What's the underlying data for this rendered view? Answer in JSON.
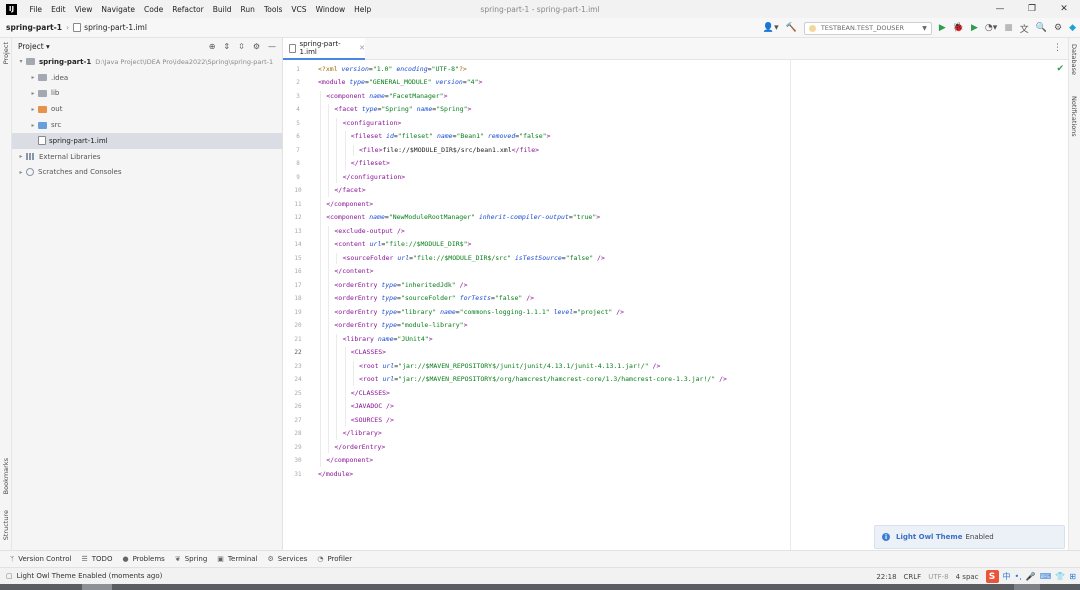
{
  "window": {
    "title": "spring-part-1 - spring-part-1.iml",
    "logo": "IJ",
    "menu": [
      "File",
      "Edit",
      "View",
      "Navigate",
      "Code",
      "Refactor",
      "Build",
      "Run",
      "Tools",
      "VCS",
      "Window",
      "Help"
    ]
  },
  "navbar": {
    "project": "spring-part-1",
    "file": "spring-part-1.iml",
    "run_config": "TESTBEAN.TEST_DOUSER"
  },
  "left_strip": {
    "top": "Project",
    "bookmarks": "Bookmarks",
    "structure": "Structure"
  },
  "right_strip": {
    "database": "Database",
    "notifications": "Notifications"
  },
  "project_panel": {
    "title": "Project",
    "tree": [
      {
        "label": "spring-part-1",
        "path": "D:\\Java Project\\IDEA Pro\\idea2022\\Spring\\spring-part-1",
        "indent": 0,
        "arrow": "▾",
        "icon": "folder-grey",
        "bold": true
      },
      {
        "label": ".idea",
        "indent": 1,
        "arrow": "▸",
        "icon": "folder-grey"
      },
      {
        "label": "lib",
        "indent": 1,
        "arrow": "▸",
        "icon": "folder-grey"
      },
      {
        "label": "out",
        "indent": 1,
        "arrow": "▸",
        "icon": "folder-orange"
      },
      {
        "label": "src",
        "indent": 1,
        "arrow": "▸",
        "icon": "folder-blue"
      },
      {
        "label": "spring-part-1.iml",
        "indent": 1,
        "arrow": "",
        "icon": "file",
        "selected": true
      },
      {
        "label": "External Libraries",
        "indent": 0,
        "arrow": "▸",
        "icon": "lib"
      },
      {
        "label": "Scratches and Consoles",
        "indent": 0,
        "arrow": "▸",
        "icon": "scratch"
      }
    ]
  },
  "editor": {
    "tab": "spring-part-1.iml",
    "active_line": 22,
    "lines": [
      {
        "n": 1,
        "indent": 0,
        "tokens": [
          [
            "pi",
            "<?xml "
          ],
          [
            "a",
            "version"
          ],
          [
            "p",
            "="
          ],
          [
            "v",
            "\"1.0\""
          ],
          [
            "p",
            " "
          ],
          [
            "a",
            "encoding"
          ],
          [
            "p",
            "="
          ],
          [
            "v",
            "\"UTF-8\""
          ],
          [
            "pi",
            "?>"
          ]
        ]
      },
      {
        "n": 2,
        "indent": 0,
        "tokens": [
          [
            "t",
            "<module "
          ],
          [
            "a",
            "type"
          ],
          [
            "p",
            "="
          ],
          [
            "v",
            "\"GENERAL_MODULE\""
          ],
          [
            "p",
            " "
          ],
          [
            "a",
            "version"
          ],
          [
            "p",
            "="
          ],
          [
            "v",
            "\"4\""
          ],
          [
            "t",
            ">"
          ]
        ]
      },
      {
        "n": 3,
        "indent": 1,
        "tokens": [
          [
            "t",
            "<component "
          ],
          [
            "a",
            "name"
          ],
          [
            "p",
            "="
          ],
          [
            "v",
            "\"FacetManager\""
          ],
          [
            "t",
            ">"
          ]
        ]
      },
      {
        "n": 4,
        "indent": 2,
        "tokens": [
          [
            "t",
            "<facet "
          ],
          [
            "a",
            "type"
          ],
          [
            "p",
            "="
          ],
          [
            "v",
            "\"Spring\""
          ],
          [
            "p",
            " "
          ],
          [
            "a",
            "name"
          ],
          [
            "p",
            "="
          ],
          [
            "v",
            "\"Spring\""
          ],
          [
            "t",
            ">"
          ]
        ]
      },
      {
        "n": 5,
        "indent": 3,
        "tokens": [
          [
            "t",
            "<configuration>"
          ]
        ]
      },
      {
        "n": 6,
        "indent": 4,
        "tokens": [
          [
            "t",
            "<fileset "
          ],
          [
            "a",
            "id"
          ],
          [
            "p",
            "="
          ],
          [
            "v",
            "\"fileset\""
          ],
          [
            "p",
            " "
          ],
          [
            "a",
            "name"
          ],
          [
            "p",
            "="
          ],
          [
            "v",
            "\"Bean1\""
          ],
          [
            "p",
            " "
          ],
          [
            "a",
            "removed"
          ],
          [
            "p",
            "="
          ],
          [
            "v",
            "\"false\""
          ],
          [
            "t",
            ">"
          ]
        ]
      },
      {
        "n": 7,
        "indent": 5,
        "tokens": [
          [
            "t",
            "<file>"
          ],
          [
            "p",
            "file://$MODULE_DIR$/src/bean1.xml"
          ],
          [
            "t",
            "</file>"
          ]
        ]
      },
      {
        "n": 8,
        "indent": 4,
        "tokens": [
          [
            "t",
            "</fileset>"
          ]
        ]
      },
      {
        "n": 9,
        "indent": 3,
        "tokens": [
          [
            "t",
            "</configuration>"
          ]
        ]
      },
      {
        "n": 10,
        "indent": 2,
        "tokens": [
          [
            "t",
            "</facet>"
          ]
        ]
      },
      {
        "n": 11,
        "indent": 1,
        "tokens": [
          [
            "t",
            "</component>"
          ]
        ]
      },
      {
        "n": 12,
        "indent": 1,
        "tokens": [
          [
            "t",
            "<component "
          ],
          [
            "a",
            "name"
          ],
          [
            "p",
            "="
          ],
          [
            "v",
            "\"NewModuleRootManager\""
          ],
          [
            "p",
            " "
          ],
          [
            "a",
            "inherit-compiler-output"
          ],
          [
            "p",
            "="
          ],
          [
            "v",
            "\"true\""
          ],
          [
            "t",
            ">"
          ]
        ]
      },
      {
        "n": 13,
        "indent": 2,
        "tokens": [
          [
            "t",
            "<exclude-output "
          ],
          [
            "t",
            "/>"
          ]
        ]
      },
      {
        "n": 14,
        "indent": 2,
        "tokens": [
          [
            "t",
            "<content "
          ],
          [
            "a",
            "url"
          ],
          [
            "p",
            "="
          ],
          [
            "v",
            "\"file://$MODULE_DIR$\""
          ],
          [
            "t",
            ">"
          ]
        ]
      },
      {
        "n": 15,
        "indent": 3,
        "tokens": [
          [
            "t",
            "<sourceFolder "
          ],
          [
            "a",
            "url"
          ],
          [
            "p",
            "="
          ],
          [
            "v",
            "\"file://$MODULE_DIR$/src\""
          ],
          [
            "p",
            " "
          ],
          [
            "a",
            "isTestSource"
          ],
          [
            "p",
            "="
          ],
          [
            "v",
            "\"false\""
          ],
          [
            "p",
            " "
          ],
          [
            "t",
            "/>"
          ]
        ]
      },
      {
        "n": 16,
        "indent": 2,
        "tokens": [
          [
            "t",
            "</content>"
          ]
        ]
      },
      {
        "n": 17,
        "indent": 2,
        "tokens": [
          [
            "t",
            "<orderEntry "
          ],
          [
            "a",
            "type"
          ],
          [
            "p",
            "="
          ],
          [
            "v",
            "\"inheritedJdk\""
          ],
          [
            "p",
            " "
          ],
          [
            "t",
            "/>"
          ]
        ]
      },
      {
        "n": 18,
        "indent": 2,
        "tokens": [
          [
            "t",
            "<orderEntry "
          ],
          [
            "a",
            "type"
          ],
          [
            "p",
            "="
          ],
          [
            "v",
            "\"sourceFolder\""
          ],
          [
            "p",
            " "
          ],
          [
            "a",
            "forTests"
          ],
          [
            "p",
            "="
          ],
          [
            "v",
            "\"false\""
          ],
          [
            "p",
            " "
          ],
          [
            "t",
            "/>"
          ]
        ]
      },
      {
        "n": 19,
        "indent": 2,
        "tokens": [
          [
            "t",
            "<orderEntry "
          ],
          [
            "a",
            "type"
          ],
          [
            "p",
            "="
          ],
          [
            "v",
            "\"library\""
          ],
          [
            "p",
            " "
          ],
          [
            "a",
            "name"
          ],
          [
            "p",
            "="
          ],
          [
            "v",
            "\"commons-logging-1.1.1\""
          ],
          [
            "p",
            " "
          ],
          [
            "a",
            "level"
          ],
          [
            "p",
            "="
          ],
          [
            "v",
            "\"project\""
          ],
          [
            "p",
            " "
          ],
          [
            "t",
            "/>"
          ]
        ]
      },
      {
        "n": 20,
        "indent": 2,
        "tokens": [
          [
            "t",
            "<orderEntry "
          ],
          [
            "a",
            "type"
          ],
          [
            "p",
            "="
          ],
          [
            "v",
            "\"module-library\""
          ],
          [
            "t",
            ">"
          ]
        ]
      },
      {
        "n": 21,
        "indent": 3,
        "tokens": [
          [
            "t",
            "<library "
          ],
          [
            "a",
            "name"
          ],
          [
            "p",
            "="
          ],
          [
            "v",
            "\"JUnit4\""
          ],
          [
            "t",
            ">"
          ]
        ]
      },
      {
        "n": 22,
        "indent": 4,
        "tokens": [
          [
            "t",
            "<CLASSES>"
          ]
        ]
      },
      {
        "n": 23,
        "indent": 5,
        "tokens": [
          [
            "t",
            "<root "
          ],
          [
            "a",
            "url"
          ],
          [
            "p",
            "="
          ],
          [
            "v",
            "\"jar://$MAVEN_REPOSITORY$/junit/junit/4.13.1/junit-4.13.1.jar!/\""
          ],
          [
            "p",
            " "
          ],
          [
            "t",
            "/>"
          ]
        ]
      },
      {
        "n": 24,
        "indent": 5,
        "tokens": [
          [
            "t",
            "<root "
          ],
          [
            "a",
            "url"
          ],
          [
            "p",
            "="
          ],
          [
            "v",
            "\"jar://$MAVEN_REPOSITORY$/org/hamcrest/hamcrest-core/1.3/hamcrest-core-1.3.jar!/\""
          ],
          [
            "p",
            " "
          ],
          [
            "t",
            "/>"
          ]
        ]
      },
      {
        "n": 25,
        "indent": 4,
        "tokens": [
          [
            "t",
            "</CLASSES>"
          ]
        ]
      },
      {
        "n": 26,
        "indent": 4,
        "tokens": [
          [
            "t",
            "<JAVADOC "
          ],
          [
            "t",
            "/>"
          ]
        ]
      },
      {
        "n": 27,
        "indent": 4,
        "tokens": [
          [
            "t",
            "<SOURCES "
          ],
          [
            "t",
            "/>"
          ]
        ]
      },
      {
        "n": 28,
        "indent": 3,
        "tokens": [
          [
            "t",
            "</library>"
          ]
        ]
      },
      {
        "n": 29,
        "indent": 2,
        "tokens": [
          [
            "t",
            "</orderEntry>"
          ]
        ]
      },
      {
        "n": 30,
        "indent": 1,
        "tokens": [
          [
            "t",
            "</component>"
          ]
        ]
      },
      {
        "n": 31,
        "indent": 0,
        "tokens": [
          [
            "t",
            "</module>"
          ]
        ]
      }
    ]
  },
  "notification": {
    "title": "Light Owl Theme",
    "message": "Enabled"
  },
  "tool_windows": [
    {
      "icon": "branch-icon",
      "glyph": "ᛘ",
      "label": "Version Control"
    },
    {
      "icon": "todo-icon",
      "glyph": "☰",
      "label": "TODO"
    },
    {
      "icon": "problems-icon",
      "glyph": "●",
      "label": "Problems"
    },
    {
      "icon": "spring-icon",
      "glyph": "❦",
      "label": "Spring"
    },
    {
      "icon": "terminal-icon",
      "glyph": "▣",
      "label": "Terminal"
    },
    {
      "icon": "services-icon",
      "glyph": "⚙",
      "label": "Services"
    },
    {
      "icon": "profiler-icon",
      "glyph": "◔",
      "label": "Profiler"
    }
  ],
  "statusbar": {
    "message": "Light Owl Theme Enabled (moments ago)",
    "position": "22:18",
    "line_sep": "CRLF",
    "encoding": "UTF-8",
    "indent": "4 spac",
    "ime_char": "中"
  }
}
